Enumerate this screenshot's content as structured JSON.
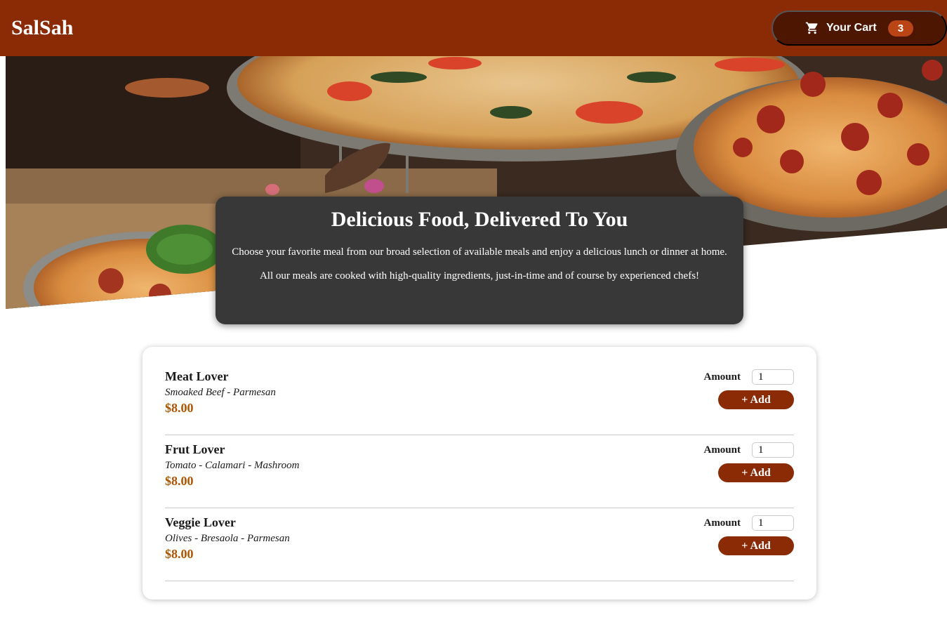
{
  "header": {
    "brand": "SalSah",
    "cart_label": "Your Cart",
    "cart_count": "3",
    "cart_icon": "cart-icon"
  },
  "summary": {
    "title": "Delicious Food, Delivered To You",
    "paragraph1": "Choose your favorite meal from our broad selection of available meals and enjoy a delicious lunch or dinner at home.",
    "paragraph2": "All our meals are cooked with high-quality ingredients, just-in-time and of course by experienced chefs!"
  },
  "meals": [
    {
      "name": "Meat Lover",
      "description": "Smoaked Beef - Parmesan",
      "price": "$8.00",
      "amount_label": "Amount",
      "amount": "1",
      "add_label": "+ Add"
    },
    {
      "name": "Frut Lover",
      "description": "Tomato - Calamari - Mashroom",
      "price": "$8.00",
      "amount_label": "Amount",
      "amount": "1",
      "add_label": "+ Add"
    },
    {
      "name": "Veggie Lover",
      "description": "Olives - Bresaola - Parmesan",
      "price": "$8.00",
      "amount_label": "Amount",
      "amount": "1",
      "add_label": "+ Add"
    }
  ],
  "colors": {
    "header": "#8a2b06",
    "cart_button": "#4d1601",
    "badge": "#b94517",
    "price": "#ad5502",
    "summary_bg": "#383838"
  }
}
